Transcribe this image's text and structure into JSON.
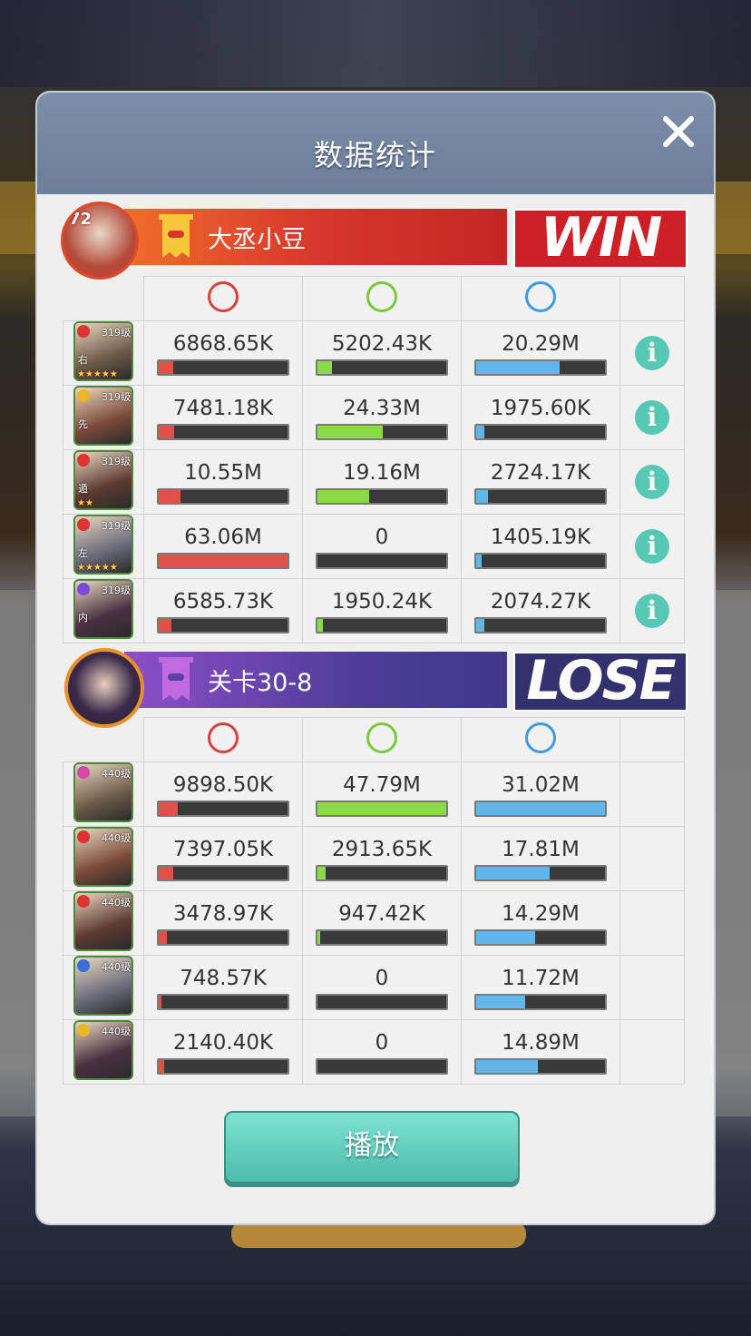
{
  "dialog": {
    "title": "数据统计",
    "play_label": "播放"
  },
  "colors": {
    "damage": "#e2504a",
    "heal": "#8ad946",
    "shield": "#5fb7ec",
    "win": "#cc1f26",
    "lose": "#33326e"
  },
  "player": {
    "name": "大丞小豆",
    "level": "72",
    "result": "WIN",
    "heroes": [
      {
        "level": "319级",
        "tag": "右",
        "stars": "★★★★★",
        "gem": "#d33",
        "icon": "hero-portrait",
        "damage": "6868.65K",
        "heal": "5202.43K",
        "shield": "20.29M",
        "damage_pct": 0.11,
        "heal_pct": 0.11,
        "shield_pct": 0.65
      },
      {
        "level": "319级",
        "tag": "先",
        "stars": "",
        "gem": "#e9b628",
        "icon": "hero-portrait",
        "damage": "7481.18K",
        "heal": "24.33M",
        "shield": "1975.60K",
        "damage_pct": 0.12,
        "heal_pct": 0.51,
        "shield_pct": 0.06
      },
      {
        "level": "319级",
        "tag": "遁",
        "stars": "★★",
        "gem": "#d33",
        "icon": "hero-portrait",
        "damage": "10.55M",
        "heal": "19.16M",
        "shield": "2724.17K",
        "damage_pct": 0.17,
        "heal_pct": 0.4,
        "shield_pct": 0.09
      },
      {
        "level": "319级",
        "tag": "左",
        "stars": "★★★★★",
        "gem": "#d33",
        "icon": "hero-portrait",
        "damage": "63.06M",
        "heal": "0",
        "shield": "1405.19K",
        "damage_pct": 1.0,
        "heal_pct": 0,
        "shield_pct": 0.04
      },
      {
        "level": "319级",
        "tag": "内",
        "stars": "",
        "gem": "#7b4ad6",
        "icon": "hero-portrait",
        "damage": "6585.73K",
        "heal": "1950.24K",
        "shield": "2074.27K",
        "damage_pct": 0.1,
        "heal_pct": 0.04,
        "shield_pct": 0.06
      }
    ]
  },
  "enemy": {
    "name": "关卡30-8",
    "result": "LOSE",
    "heroes": [
      {
        "level": "440级",
        "gem": "#d946a8",
        "icon": "hero-portrait",
        "damage": "9898.50K",
        "heal": "47.79M",
        "shield": "31.02M",
        "damage_pct": 0.15,
        "heal_pct": 1.0,
        "shield_pct": 1.0
      },
      {
        "level": "440级",
        "gem": "#d33",
        "icon": "hero-portrait",
        "damage": "7397.05K",
        "heal": "2913.65K",
        "shield": "17.81M",
        "damage_pct": 0.11,
        "heal_pct": 0.06,
        "shield_pct": 0.57
      },
      {
        "level": "440级",
        "gem": "#d33",
        "icon": "hero-portrait",
        "damage": "3478.97K",
        "heal": "947.42K",
        "shield": "14.29M",
        "damage_pct": 0.06,
        "heal_pct": 0.02,
        "shield_pct": 0.46
      },
      {
        "level": "440级",
        "gem": "#3a6fd8",
        "icon": "hero-portrait",
        "damage": "748.57K",
        "heal": "0",
        "shield": "11.72M",
        "damage_pct": 0.02,
        "heal_pct": 0,
        "shield_pct": 0.38
      },
      {
        "level": "440级",
        "gem": "#e9b628",
        "icon": "hero-portrait",
        "damage": "2140.40K",
        "heal": "0",
        "shield": "14.89M",
        "damage_pct": 0.04,
        "heal_pct": 0,
        "shield_pct": 0.48
      }
    ]
  },
  "icons": {
    "attack": "attack-icon",
    "heal": "heal-cross-icon",
    "shield": "shield-icon",
    "info": "info-icon",
    "close": "close-icon",
    "flag": "banner-flag-icon"
  }
}
